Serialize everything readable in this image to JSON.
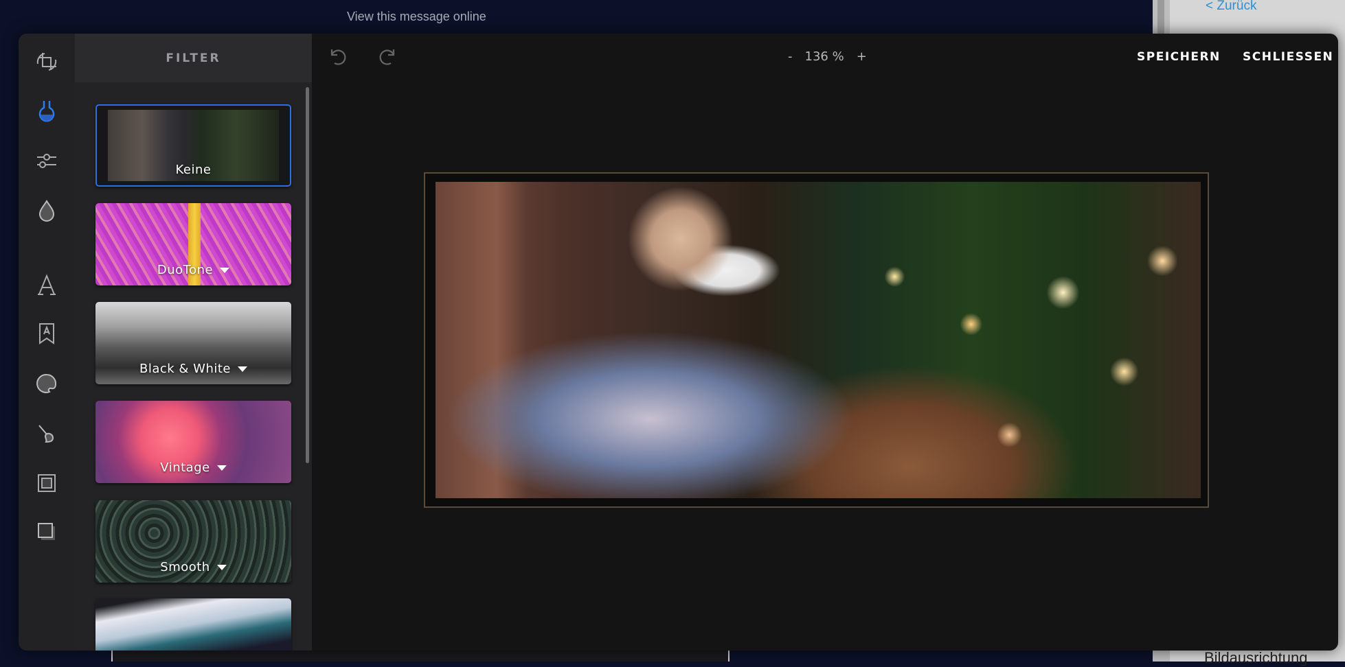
{
  "background": {
    "view_online": "View this message online",
    "back_link": "< Zurück",
    "image_alignment": "Bildausrichtung"
  },
  "editor": {
    "panel_title": "FILTER",
    "tools": [
      "crop-icon",
      "filter-icon",
      "adjust-icon",
      "focus-icon",
      "text-icon",
      "sticker-icon",
      "overlay-icon",
      "brush-icon",
      "frame-icon",
      "shadow-icon"
    ],
    "active_tool": "filter-icon",
    "accent_color": "#2d6fe0",
    "filters": [
      {
        "label": "Keine",
        "selected": true,
        "has_dropdown": false
      },
      {
        "label": "DuoTone",
        "selected": false,
        "has_dropdown": true
      },
      {
        "label": "Black & White",
        "selected": false,
        "has_dropdown": true
      },
      {
        "label": "Vintage",
        "selected": false,
        "has_dropdown": true
      },
      {
        "label": "Smooth",
        "selected": false,
        "has_dropdown": true
      },
      {
        "label": "",
        "selected": false,
        "has_dropdown": false
      }
    ],
    "zoom": {
      "minus": "-",
      "value": "136 %",
      "plus": "+"
    },
    "save_label": "SPEICHERN",
    "close_label": "SCHLIESSEN"
  }
}
